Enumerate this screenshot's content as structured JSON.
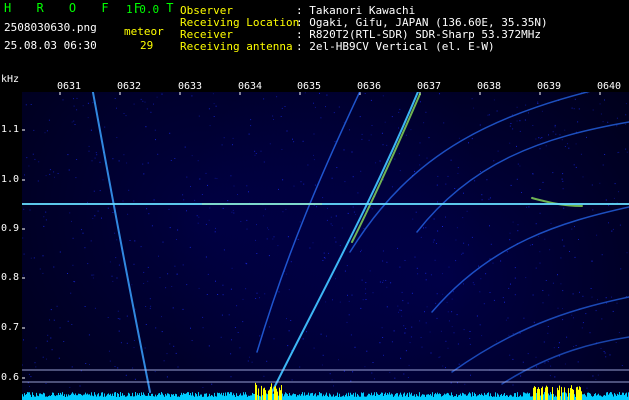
{
  "header": {
    "app_name": "H R O F F T",
    "version": "1.0.0",
    "filename": "2508030630.png",
    "datetime": "25.08.03 06:30",
    "meteor_label": "meteor",
    "meteor_count": "29",
    "info": [
      {
        "label": "Observer",
        "value": ": Takanori Kawachi"
      },
      {
        "label": "Receiving Location",
        "value": ": Ogaki, Gifu, JAPAN (136.60E, 35.35N)"
      },
      {
        "label": "Receiver",
        "value": ": R820T2(RTL-SDR) SDR-Sharp 53.372MHz"
      },
      {
        "label": "Receiving antenna",
        "value": ": 2el-HB9CV Vertical (el. E-W)"
      }
    ]
  },
  "plot": {
    "y_unit": "kHz",
    "x_ticks": [
      "0631",
      "0632",
      "0633",
      "0634",
      "0635",
      "0636",
      "0637",
      "0638",
      "0639",
      "0640"
    ],
    "y_ticks": [
      "1.1",
      "1.0",
      "0.9",
      "0.8",
      "0.7",
      "0.6"
    ],
    "colors": {
      "background": "#000018",
      "noise": "#1a2dff",
      "trail": "#40c0ff",
      "carrier": "#66ddff",
      "spectrum": "#00ccff",
      "peak": "#ffff00"
    }
  }
}
